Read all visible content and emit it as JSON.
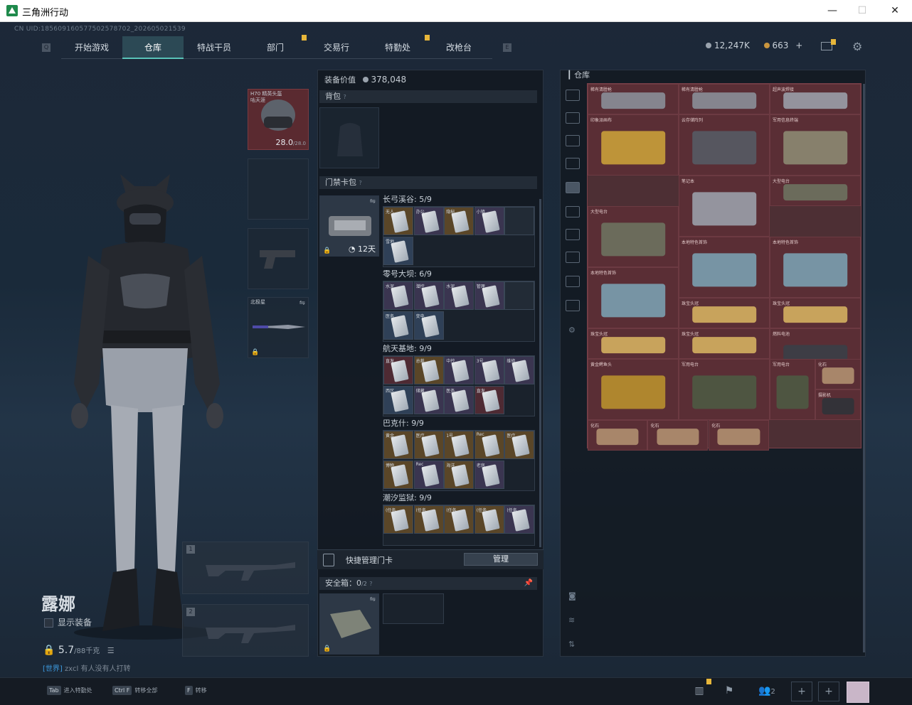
{
  "window": {
    "title": "三角洲行动",
    "minimize": "—",
    "maximize": "☐",
    "close": "✕"
  },
  "uid": "CN UID:1856091605775025787​02_202605021539",
  "nav": {
    "left_key": "Q",
    "right_key": "E",
    "tabs": [
      "开始游戏",
      "仓库",
      "特战干员",
      "部门",
      "交易行",
      "特勤处",
      "改枪台"
    ],
    "active": "仓库"
  },
  "currency": {
    "silver": "12,247K",
    "gold": "663",
    "plus": "+"
  },
  "character": {
    "name": "露娜",
    "show_equipment": "显示装备",
    "weight": "5.7",
    "weight_max": "/88千克"
  },
  "chat": {
    "channel": "[世界]",
    "user": "zxcl",
    "message": "有人没有人打转"
  },
  "equipment": {
    "helmet_name": "H70 精英头盔\n咕天涯",
    "helmet_durability": "28.0",
    "helmet_max": "/28.0",
    "melee_name": "北极星",
    "slot1": "1",
    "slot2": "2"
  },
  "midpanel": {
    "equipment_value_label": "装备价值",
    "equipment_value": "378,048",
    "backpack_label": "背包",
    "keycard_case_label": "门禁卡包",
    "keycard_timer": "12天",
    "safebox_label": "安全箱：",
    "safebox_count": "0",
    "safebox_max": "/2",
    "quick_manage_label": "快捷管理门卡",
    "manage_button": "管理"
  },
  "keycard_groups": [
    {
      "title": "长弓溪谷: 5/9",
      "cells": [
        {
          "label": "无人",
          "color": "gold"
        },
        {
          "label": "办公",
          "color": "purple"
        },
        {
          "label": "隐秘",
          "color": "gold"
        },
        {
          "label": "小镇",
          "color": "purple"
        },
        {
          "label": "",
          "color": "empty"
        },
        {
          "label": "雪地",
          "color": "blue"
        }
      ]
    },
    {
      "title": "零号大坝: 6/9",
      "cells": [
        {
          "label": "水泥",
          "color": "purple"
        },
        {
          "label": "潜控",
          "color": "purple"
        },
        {
          "label": "水泥",
          "color": "purple"
        },
        {
          "label": "管理",
          "color": "purple"
        },
        {
          "label": "",
          "color": "empty"
        },
        {
          "label": "医务",
          "color": "blue"
        },
        {
          "label": "变电",
          "color": "blue"
        }
      ]
    },
    {
      "title": "航天基地: 9/9",
      "cells": [
        {
          "label": "直发",
          "color": "red"
        },
        {
          "label": "总裁",
          "color": "gold"
        },
        {
          "label": "中控",
          "color": "purple"
        },
        {
          "label": "3号",
          "color": "purple"
        },
        {
          "label": "维修",
          "color": "purple"
        },
        {
          "label": "西区",
          "color": "blue"
        },
        {
          "label": "储藏",
          "color": "purple"
        },
        {
          "label": "医务",
          "color": "purple"
        },
        {
          "label": "直发",
          "color": "red"
        }
      ]
    },
    {
      "title": "巴克什: 9/9",
      "cells": [
        {
          "label": "黄金",
          "color": "gold"
        },
        {
          "label": "医疗",
          "color": "gold"
        },
        {
          "label": "1号",
          "color": "gold"
        },
        {
          "label": "Rec",
          "color": "gold"
        },
        {
          "label": "医疗",
          "color": "gold"
        },
        {
          "label": "博物",
          "color": "gold"
        },
        {
          "label": "Rec",
          "color": "purple"
        },
        {
          "label": "海洋",
          "color": "gold"
        },
        {
          "label": "老房",
          "color": "purple"
        }
      ]
    },
    {
      "title": "潮汐监狱: 9/9",
      "cells": [
        {
          "label": "(任务",
          "color": "gold"
        },
        {
          "label": "(任务",
          "color": "gold"
        },
        {
          "label": "(任务",
          "color": "gold"
        },
        {
          "label": "(任务",
          "color": "gold"
        },
        {
          "label": "(任务",
          "color": "purple"
        }
      ]
    }
  ],
  "stash": {
    "label": "仓库"
  },
  "stash_items": [
    {
      "name": "稀有清膛枪",
      "w": 1,
      "h": 1
    },
    {
      "name": "稀有清膛枪",
      "w": 1,
      "h": 1
    },
    {
      "name": "超声波焊接",
      "w": 1,
      "h": 1
    },
    {
      "name": "印象派画布",
      "w": 1,
      "h": 1
    },
    {
      "name": "云存储阵列",
      "w": 1,
      "h": 1
    },
    {
      "name": "军用信息终端",
      "w": 1,
      "h": 1
    },
    {
      "name": "笔记本",
      "w": 1,
      "h": 1
    },
    {
      "name": "大型电台",
      "w": 1,
      "h": 1
    },
    {
      "name": "大型电台",
      "w": 1,
      "h": 1
    },
    {
      "name": "本地特色首饰",
      "w": 1,
      "h": 1
    },
    {
      "name": "本地特色首饰",
      "w": 1,
      "h": 1
    },
    {
      "name": "本地特色首饰",
      "w": 1,
      "h": 1
    },
    {
      "name": "珠宝头冠",
      "w": 1,
      "h": 1
    },
    {
      "name": "珠宝头冠",
      "w": 1,
      "h": 1
    },
    {
      "name": "珠宝头冠",
      "w": 1,
      "h": 1
    },
    {
      "name": "珠宝头冠",
      "w": 1,
      "h": 1
    },
    {
      "name": "燃料电池",
      "w": 1,
      "h": 1
    },
    {
      "name": "黄金鳄鱼头",
      "w": 1,
      "h": 1
    },
    {
      "name": "军用电台",
      "w": 1,
      "h": 1
    },
    {
      "name": "军用电台",
      "w": 1,
      "h": 1
    },
    {
      "name": "摄影机",
      "w": 1,
      "h": 1
    },
    {
      "name": "化石",
      "w": 1,
      "h": 1
    },
    {
      "name": "化石",
      "w": 1,
      "h": 1
    },
    {
      "name": "化石",
      "w": 1,
      "h": 1
    },
    {
      "name": "化石",
      "w": 1,
      "h": 1
    }
  ],
  "bottom": {
    "hint1_key": "Tab",
    "hint1": "进入特勤处",
    "hint2_key": "Ctrl F",
    "hint2": "转移全部",
    "hint3_key": "F",
    "hint3": "转移",
    "friends": "2"
  },
  "colors": {
    "accent": "#59c3b8",
    "stash_bg": "#4d2f34",
    "badge": "#e7b63a"
  }
}
